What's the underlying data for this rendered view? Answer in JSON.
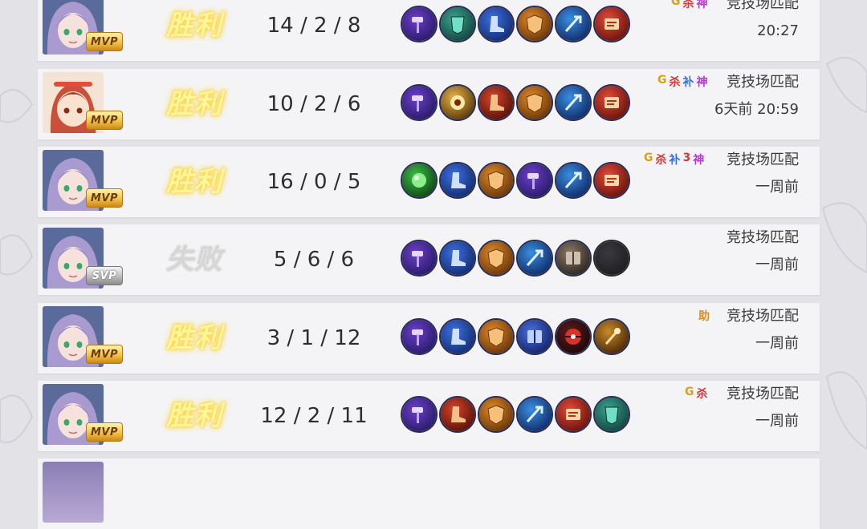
{
  "matches": [
    {
      "hero": "purple-haired-heroine",
      "badge": "MVP",
      "result": "胜利",
      "result_type": "win",
      "kda": "14 / 2 / 8",
      "items": [
        "purple-hammer",
        "teal-armor",
        "blue-boots",
        "orange-shield",
        "blue-spear",
        "red-scroll"
      ],
      "tags": [
        {
          "text": "G",
          "kind": "g"
        },
        {
          "text": "杀",
          "kind": "sha"
        },
        {
          "text": "神",
          "kind": "shen"
        }
      ],
      "mode": "竞技场匹配",
      "time": "20:27"
    },
    {
      "hero": "red-haired-girl",
      "badge": "MVP",
      "result": "胜利",
      "result_type": "win",
      "kda": "10 / 2 / 6",
      "items": [
        "purple-hammer",
        "gold-eye",
        "red-boots",
        "orange-shield",
        "blue-spear",
        "red-scroll"
      ],
      "tags": [
        {
          "text": "G",
          "kind": "g"
        },
        {
          "text": "杀",
          "kind": "sha"
        },
        {
          "text": "补",
          "kind": "bu"
        },
        {
          "text": "神",
          "kind": "shen"
        }
      ],
      "mode": "竞技场匹配",
      "time": "6天前  20:59"
    },
    {
      "hero": "purple-haired-heroine",
      "badge": "MVP",
      "result": "胜利",
      "result_type": "win",
      "kda": "16 / 0 / 5",
      "items": [
        "green-orb",
        "blue-boots",
        "orange-shield",
        "purple-hammer",
        "blue-spear",
        "red-scroll"
      ],
      "tags": [
        {
          "text": "G",
          "kind": "g"
        },
        {
          "text": "杀",
          "kind": "sha"
        },
        {
          "text": "补",
          "kind": "bu"
        },
        {
          "text": "3",
          "kind": "three"
        },
        {
          "text": "神",
          "kind": "shen"
        }
      ],
      "mode": "竞技场匹配",
      "time": "一周前"
    },
    {
      "hero": "purple-haired-heroine",
      "badge": "SVP",
      "result": "失败",
      "result_type": "lose",
      "kda": "5 / 6 / 6",
      "items": [
        "purple-hammer",
        "blue-boots",
        "orange-shield",
        "blue-spear",
        "stone-book",
        "empty-slot"
      ],
      "tags": [],
      "mode": "竞技场匹配",
      "time": "一周前"
    },
    {
      "hero": "purple-haired-heroine",
      "badge": "MVP",
      "result": "胜利",
      "result_type": "win",
      "kda": "3 / 1 / 12",
      "items": [
        "purple-hammer",
        "blue-boots",
        "orange-shield",
        "blue-book",
        "red-ball",
        "gold-staff"
      ],
      "tags": [
        {
          "text": "助",
          "kind": "zhu"
        }
      ],
      "mode": "竞技场匹配",
      "time": "一周前"
    },
    {
      "hero": "purple-haired-heroine",
      "badge": "MVP",
      "result": "胜利",
      "result_type": "win",
      "kda": "12 / 2 / 11",
      "items": [
        "purple-hammer",
        "red-boots",
        "orange-shield",
        "blue-spear",
        "red-scroll",
        "teal-armor"
      ],
      "tags": [
        {
          "text": "G",
          "kind": "g"
        },
        {
          "text": "杀",
          "kind": "sha"
        }
      ],
      "mode": "竞技场匹配",
      "time": "一周前"
    }
  ],
  "colors": {
    "win_text": "#fff59a",
    "lose_text": "#d6d6d6",
    "row_bg": "#f4f4f6",
    "page_bg": "#e3e2e7"
  }
}
